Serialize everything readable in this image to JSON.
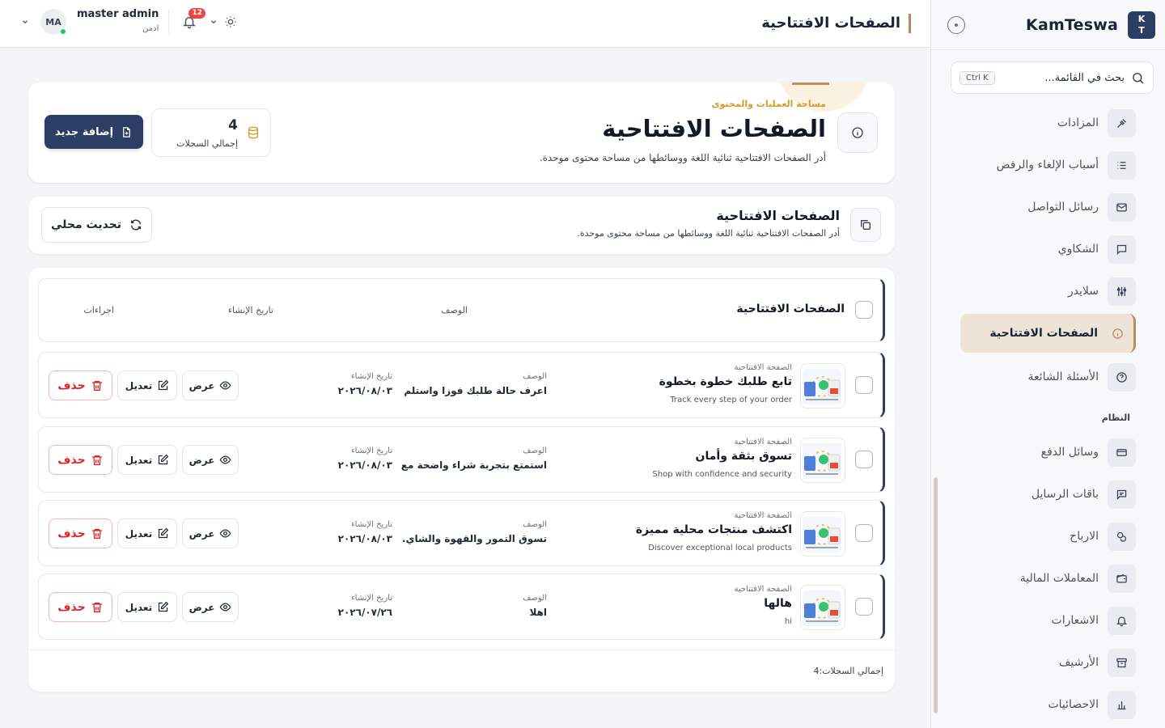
{
  "sidebar": {
    "logo_letters": [
      "K",
      "T"
    ],
    "brand": "KamTeswa",
    "search_placeholder": "بحث في القائمة...",
    "search_shortcut": "Ctrl K",
    "items": [
      {
        "label": "المزادات",
        "icon": "gavel-icon"
      },
      {
        "label": "أسباب الإلغاء والرفض",
        "icon": "list-icon"
      },
      {
        "label": "رسائل التواصل",
        "icon": "mail-icon"
      },
      {
        "label": "الشكاوي",
        "icon": "message-icon"
      },
      {
        "label": "سلايدر",
        "icon": "sliders-icon"
      },
      {
        "label": "الصفحات الافتتاحية",
        "icon": "info-icon",
        "active": true
      },
      {
        "label": "الأسئلة الشائعة",
        "icon": "help-icon"
      }
    ],
    "system_section": "النظام",
    "system_items": [
      {
        "label": "وسائل الدفع",
        "icon": "card-icon"
      },
      {
        "label": "باقات الرسايل",
        "icon": "chat-icon"
      },
      {
        "label": "الارباح",
        "icon": "coins-icon"
      },
      {
        "label": "المعاملات المالية",
        "icon": "wallet-icon"
      },
      {
        "label": "الاشعارات",
        "icon": "bell-icon"
      },
      {
        "label": "الأرشيف",
        "icon": "archive-icon"
      },
      {
        "label": "الاحصائيات",
        "icon": "chart-icon"
      }
    ]
  },
  "topbar": {
    "title": "الصفحات الافتتاحية",
    "user_name": "master admin",
    "user_role": "ادمن",
    "avatar_initials": "MA",
    "notification_count": "12"
  },
  "hero": {
    "kicker": "مساحة العمليات والمحتوى",
    "title": "الصفحات الافتتاحية",
    "subtitle": "أدر الصفحات الافتتاحية ثنائية اللغة ووسائطها من مساحة محتوى موحدة.",
    "stat_value": "4",
    "stat_label": "إجمالي السجلات",
    "add_label": "إضافة جديد"
  },
  "section": {
    "title": "الصفحات الافتتاحية",
    "subtitle": "أدر الصفحات الافتتاحية ثنائية اللغة ووسائطها من مساحة محتوى موحدة.",
    "refresh_label": "تحديث محلي"
  },
  "table": {
    "headers": {
      "main": "الصفحات الافتتاحية",
      "description": "الوصف",
      "created": "تاريخ الإنشاء",
      "actions": "اجراءات"
    },
    "row_kicker": "الصفحة الافتتاحية",
    "desc_label": "الوصف",
    "date_label": "تاريخ الإنشاء",
    "view_label": "عرض",
    "edit_label": "تعديل",
    "delete_label": "حذف",
    "rows": [
      {
        "title": "تابع طلبك خطوة بخطوة",
        "subtitle": "Track every step of your order",
        "description": "اعرف حالة طلبك فوزا واستلم تن...",
        "date": "٢٠٢٦/٠٨/٠٣"
      },
      {
        "title": "تسوق بثقة وأمان",
        "subtitle": "Shop with confidence and security",
        "description": "استمتع بتجربة شراء واضحة مع ...",
        "date": "٢٠٢٦/٠٨/٠٣"
      },
      {
        "title": "اكتشف منتجات محلية مميزة",
        "subtitle": "Discover exceptional local products",
        "description": "تسوق التمور والقهوة والشاي...",
        "date": "٢٠٢٦/٠٨/٠٣"
      },
      {
        "title": "هالها",
        "subtitle": "hi",
        "description": "اهلا",
        "date": "٢٠٢٦/٠٧/٢٦"
      }
    ],
    "footer": "إجمالي السجلات:4"
  }
}
